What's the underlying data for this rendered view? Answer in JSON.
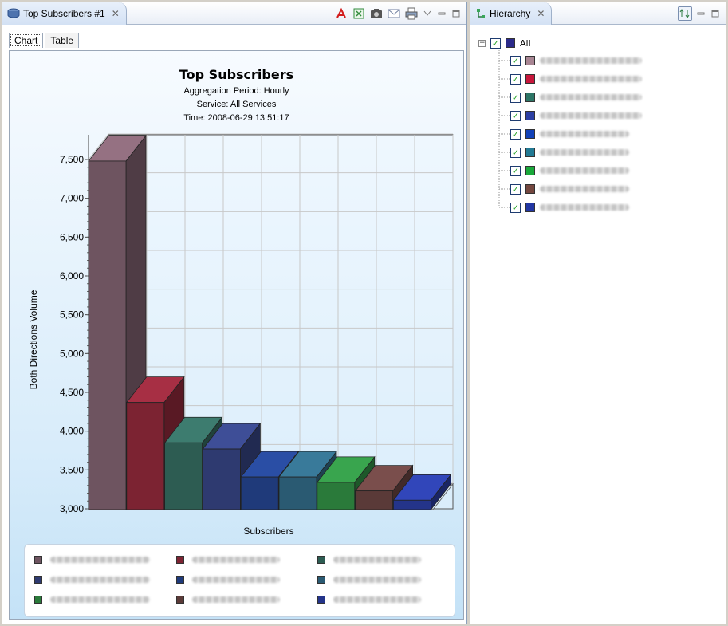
{
  "left_view": {
    "tab_title": "Top Subscribers #1",
    "close_glyph": "✕",
    "toolbar_icons": [
      "pdf-export-icon",
      "excel-export-icon",
      "camera-icon",
      "email-icon",
      "print-icon",
      "view-menu-icon"
    ],
    "inner_tabs": [
      {
        "label": "Chart",
        "active": true
      },
      {
        "label": "Table",
        "active": false
      }
    ]
  },
  "right_view": {
    "tab_title": "Hierarchy",
    "close_glyph": "✕",
    "root_label": "All",
    "root_color": "#2b2a8a",
    "items": [
      {
        "color": "#a88593"
      },
      {
        "color": "#c8173c"
      },
      {
        "color": "#2d7566"
      },
      {
        "color": "#2c3fa3"
      },
      {
        "color": "#1141b8"
      },
      {
        "color": "#227a94"
      },
      {
        "color": "#19a83a"
      },
      {
        "color": "#74473f"
      },
      {
        "color": "#2236a3"
      }
    ]
  },
  "chart_data": {
    "type": "bar",
    "title": "Top Subscribers",
    "subtitles": [
      "Aggregation Period: Hourly",
      "Service: All Services",
      "Time: 2008-06-29 13:51:17"
    ],
    "xlabel": "Subscribers",
    "ylabel": "Both Directions Volume",
    "ylim": [
      3000,
      7750
    ],
    "yticks": [
      "3,000",
      "3,500",
      "4,000",
      "4,500",
      "5,000",
      "5,500",
      "6,000",
      "6,500",
      "7,000",
      "7,500"
    ],
    "ytick_values": [
      3000,
      3500,
      4000,
      4500,
      5000,
      5500,
      6000,
      6500,
      7000,
      7500
    ],
    "grid": true,
    "legend_position": "bottom",
    "values": [
      7480,
      4370,
      3850,
      3770,
      3410,
      3410,
      3340,
      3230,
      3110
    ],
    "colors": [
      "#6e5460",
      "#7c2332",
      "#2d5c52",
      "#2e3a70",
      "#1f3a7a",
      "#2a5a72",
      "#2a7a3a",
      "#5a3a38",
      "#24348a"
    ]
  }
}
